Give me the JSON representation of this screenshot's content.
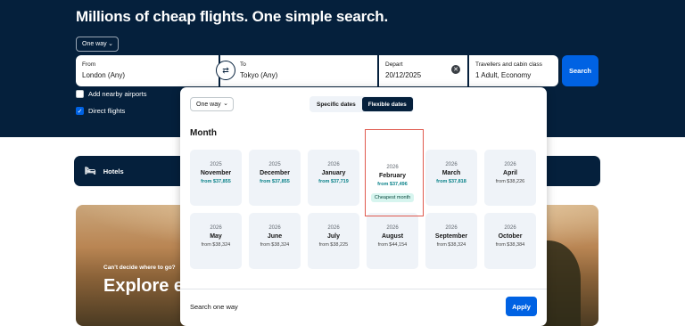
{
  "hero": {
    "title": "Millions of cheap flights. One simple search."
  },
  "trip_type": {
    "selected": "One way"
  },
  "search": {
    "from_label": "From",
    "from_value": "London (Any)",
    "to_label": "To",
    "to_value": "Tokyo (Any)",
    "depart_label": "Depart",
    "depart_value": "20/12/2025",
    "travellers_label": "Travellers and cabin class",
    "travellers_value": "1 Adult, Economy",
    "search_label": "Search",
    "swap_icon": "⇄"
  },
  "options": {
    "nearby_label": "Add nearby airports",
    "direct_label": "Direct flights",
    "nearby_checked": false,
    "direct_checked": true
  },
  "hotels": {
    "label": "Hotels"
  },
  "banner": {
    "kicker": "Can't decide where to go?",
    "title": "Explore every destination"
  },
  "picker": {
    "trip_type": "One way",
    "tab_specific": "Specific dates",
    "tab_flexible": "Flexible dates",
    "active_tab": "Flexible dates",
    "heading": "Month",
    "months": [
      {
        "year": "2025",
        "month": "November",
        "price": "from $37,855",
        "cheapest": true
      },
      {
        "year": "2025",
        "month": "December",
        "price": "from $37,855",
        "cheapest": true
      },
      {
        "year": "2026",
        "month": "January",
        "price": "from $37,719",
        "cheapest": true
      },
      {
        "year": "2026",
        "month": "February",
        "price": "from $37,496",
        "cheapest": true,
        "tag": "Cheapest month"
      },
      {
        "year": "2026",
        "month": "March",
        "price": "from $37,818",
        "cheapest": true
      },
      {
        "year": "2026",
        "month": "April",
        "price": "from $38,226",
        "cheapest": false
      },
      {
        "year": "2026",
        "month": "May",
        "price": "from $38,324",
        "cheapest": false
      },
      {
        "year": "2026",
        "month": "June",
        "price": "from $38,324",
        "cheapest": false
      },
      {
        "year": "2026",
        "month": "July",
        "price": "from $38,225",
        "cheapest": false
      },
      {
        "year": "2026",
        "month": "August",
        "price": "from $44,154",
        "cheapest": false
      },
      {
        "year": "2026",
        "month": "September",
        "price": "from $38,324",
        "cheapest": false
      },
      {
        "year": "2026",
        "month": "October",
        "price": "from $38,384",
        "cheapest": false
      }
    ],
    "footer_text": "Search one way",
    "apply_label": "Apply"
  },
  "colors": {
    "navy": "#05203c",
    "primary": "#0062e3",
    "teal": "#0c838a",
    "highlight": "#e05a4e"
  }
}
